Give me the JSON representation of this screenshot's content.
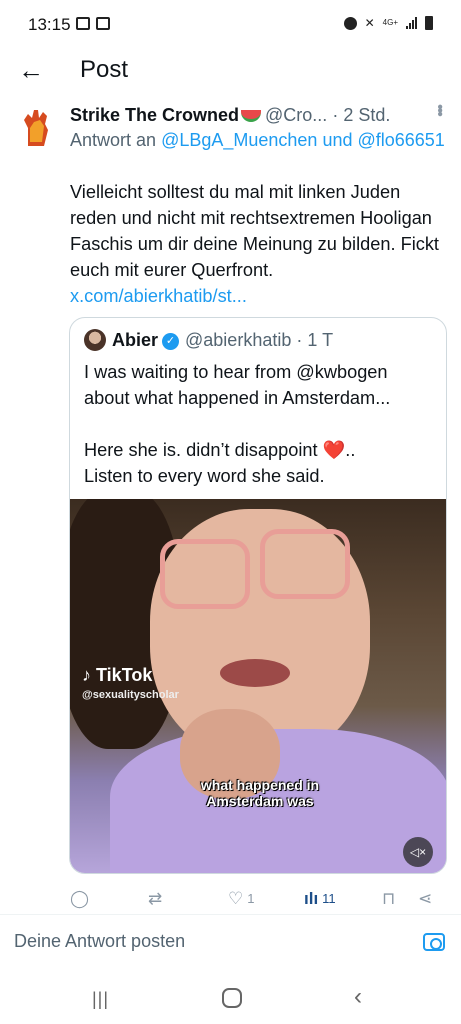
{
  "status_bar": {
    "time": "13:15",
    "network": "4G+"
  },
  "header": {
    "title": "Post"
  },
  "post": {
    "author_name": "Strike The Crowned",
    "handle": "@Cro...",
    "separator": "·",
    "time": "2 Std.",
    "reply_prefix": "Antwort an",
    "reply_mentions": "@LBgA_Muenchen und @flo66651",
    "text": "Vielleicht solltest du mal mit linken Juden reden und nicht mit rechtsextremen Hooligan Faschis um dir deine Meinung zu bilden.  Fickt euch mit eurer Querfront.",
    "url": "x.com/abierkhatib/st..."
  },
  "quote": {
    "author_name": "Abier",
    "handle": "@abierkhatib",
    "separator": "·",
    "time": "1 T",
    "line1": "I was waiting to hear from @kwbogen",
    "line2": "about what happened in Amsterdam...",
    "line3": "Here she is. didn’t disappoint",
    "line3_heart": "❤️",
    "line3_end": "..",
    "line4": "Listen to every word she said.",
    "video": {
      "watermark_logo": "TikTok",
      "watermark_user": "@sexualityscholar",
      "caption_line1": "what happened in",
      "caption_line2": "Amsterdam was"
    }
  },
  "actions": {
    "likes": "1",
    "views": "11"
  },
  "reply_bar": {
    "placeholder": "Deine Antwort posten"
  },
  "icons": {
    "back": "arrow-left",
    "reply": "speech-bubble",
    "repost": "retweet-arrows",
    "like": "heart",
    "views": "bar-chart",
    "bookmark": "bookmark",
    "share": "share",
    "camera": "camera",
    "mute": "speaker-muted"
  },
  "colors": {
    "link": "#1d9bf0",
    "secondary_text": "#536471",
    "primary_text": "#0f1419"
  }
}
